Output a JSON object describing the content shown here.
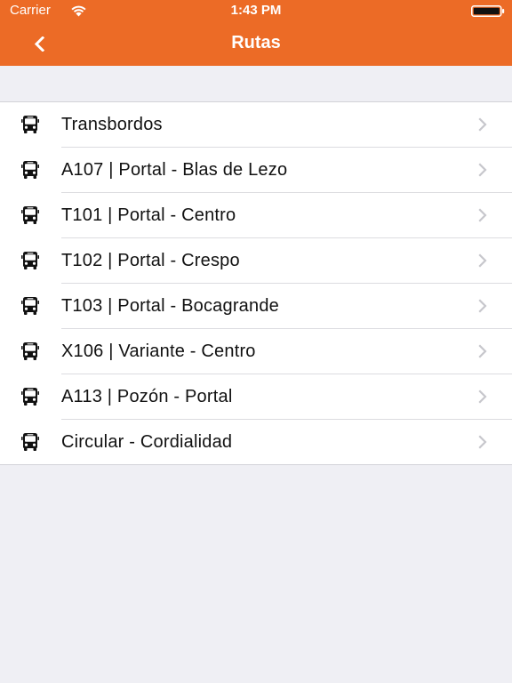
{
  "status_bar": {
    "carrier": "Carrier",
    "time": "1:43 PM",
    "wifi_icon": "wifi-icon",
    "battery_icon": "battery-icon"
  },
  "nav": {
    "title": "Rutas",
    "back_icon": "chevron-left-icon"
  },
  "colors": {
    "brand": "#ec6b26",
    "background": "#efeff4",
    "text": "#111111",
    "chevron": "#c7c7cc"
  },
  "routes": {
    "item_icon": "bus-icon",
    "disclosure_icon": "chevron-right-icon",
    "items": [
      {
        "label": "Transbordos"
      },
      {
        "label": "A107 | Portal - Blas de Lezo"
      },
      {
        "label": "T101 | Portal - Centro"
      },
      {
        "label": "T102 | Portal - Crespo"
      },
      {
        "label": "T103 | Portal - Bocagrande"
      },
      {
        "label": "X106 | Variante - Centro"
      },
      {
        "label": "A113 | Pozón - Portal"
      },
      {
        "label": "Circular - Cordialidad"
      }
    ]
  }
}
